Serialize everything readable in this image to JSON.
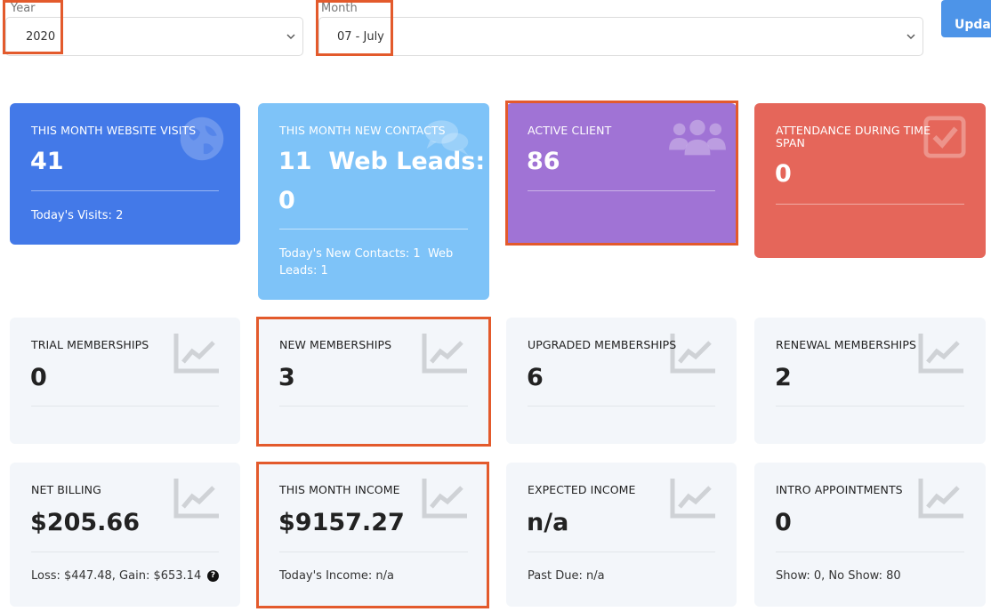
{
  "filters": {
    "year": {
      "label": "Year",
      "value": "2020"
    },
    "month": {
      "label": "Month",
      "value": "07 - July"
    },
    "update_label": "Update"
  },
  "colors": {
    "blue": "#4379e8",
    "sky": "#7ec3f8",
    "purple": "#a073d5",
    "red": "#e5665a",
    "light": "#f3f6fa",
    "highlight": "#e35a2c",
    "button": "#4d94e8"
  },
  "cards": {
    "website_visits": {
      "title": "THIS MONTH WEBSITE VISITS",
      "value": "41",
      "footer": "Today's Visits: 2",
      "icon": "globe-icon"
    },
    "new_contacts": {
      "title": "THIS MONTH NEW CONTACTS",
      "value_line1": "11  Web Leads:",
      "value_line2": "0",
      "footer": "Today's New Contacts: 1  Web Leads: 1",
      "icon": "chat-bubbles-icon"
    },
    "active_client": {
      "title": "ACTIVE CLIENT",
      "value": "86",
      "icon": "users-icon"
    },
    "attendance": {
      "title": "ATTENDANCE DURING TIME SPAN",
      "value": "0",
      "icon": "check-square-icon"
    },
    "trial_memberships": {
      "title": "TRIAL MEMBERSHIPS",
      "value": "0",
      "icon": "line-chart-icon"
    },
    "new_memberships": {
      "title": "NEW MEMBERSHIPS",
      "value": "3",
      "icon": "line-chart-icon"
    },
    "upgraded_memberships": {
      "title": "UPGRADED MEMBERSHIPS",
      "value": "6",
      "icon": "line-chart-icon"
    },
    "renewal_memberships": {
      "title": "RENEWAL MEMBERSHIPS",
      "value": "2",
      "icon": "line-chart-icon"
    },
    "net_billing": {
      "title": "NET BILLING",
      "value": "$205.66",
      "footer": "Loss: $447.48, Gain: $653.14",
      "help": "?",
      "icon": "line-chart-icon"
    },
    "month_income": {
      "title": "THIS MONTH INCOME",
      "value": "$9157.27",
      "footer": "Today's Income: n/a",
      "icon": "line-chart-icon"
    },
    "expected_income": {
      "title": "EXPECTED INCOME",
      "value": "n/a",
      "footer": "Past Due: n/a",
      "icon": "line-chart-icon"
    },
    "intro_appointments": {
      "title": "INTRO APPOINTMENTS",
      "value": "0",
      "footer": "Show: 0, No Show: 80",
      "icon": "line-chart-icon"
    }
  }
}
